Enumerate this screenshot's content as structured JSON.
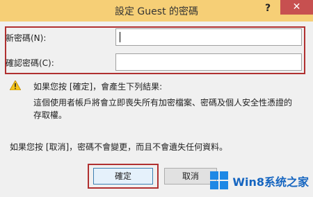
{
  "window": {
    "title": "設定 Guest 的密碼",
    "help_label": "?",
    "close_label": "✕"
  },
  "form": {
    "new_password_label": "新密碼(N):",
    "new_password_value": "",
    "confirm_password_label": "確認密碼(C):",
    "confirm_password_value": ""
  },
  "warning": {
    "icon": "warning-icon",
    "title": "如果您按 [確定]，會產生下列結果:",
    "body": "這個使用者帳戶將會立即喪失所有加密檔案、密碼及個人安全性憑證的存取權。"
  },
  "note": "如果您按 [取消]，密碼不會變更，而且不會遺失任何資料。",
  "buttons": {
    "ok": "確定",
    "cancel": "取消"
  },
  "watermark": {
    "text": "Win8系统之家"
  },
  "colors": {
    "titlebar": "#f6cf76",
    "highlight": "#b03030",
    "close": "#c75050"
  }
}
